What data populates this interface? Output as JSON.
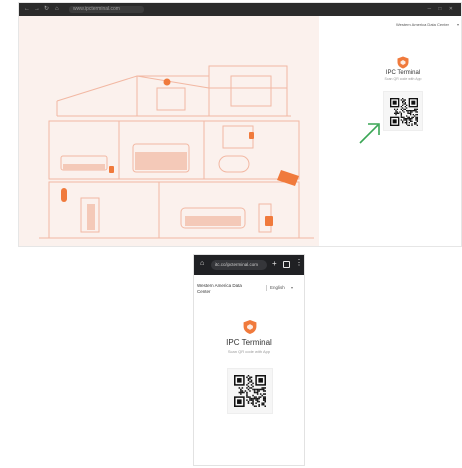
{
  "desktop": {
    "browser": {
      "url": "www.ipcterminal.com"
    },
    "region_selector": "Western America Data Center",
    "login": {
      "title": "IPC Terminal",
      "subtitle": "Scan QR code with App"
    }
  },
  "mobile": {
    "browser": {
      "url": "itc.cc/ipcterminal.com"
    },
    "region_selector": "Western America Data Center",
    "language": "English",
    "login": {
      "title": "IPC Terminal",
      "subtitle": "Scan QR code with App"
    }
  },
  "colors": {
    "brand_orange": "#f07a3c",
    "illustration_bg": "#fbf1ed",
    "illustration_stroke": "#f2b8a3",
    "arrow_green": "#3aa655",
    "browser_dark": "#202124"
  },
  "icons": {
    "logo": "shield-icon",
    "annotation": "arrow-icon",
    "code": "qr-code-icon"
  }
}
